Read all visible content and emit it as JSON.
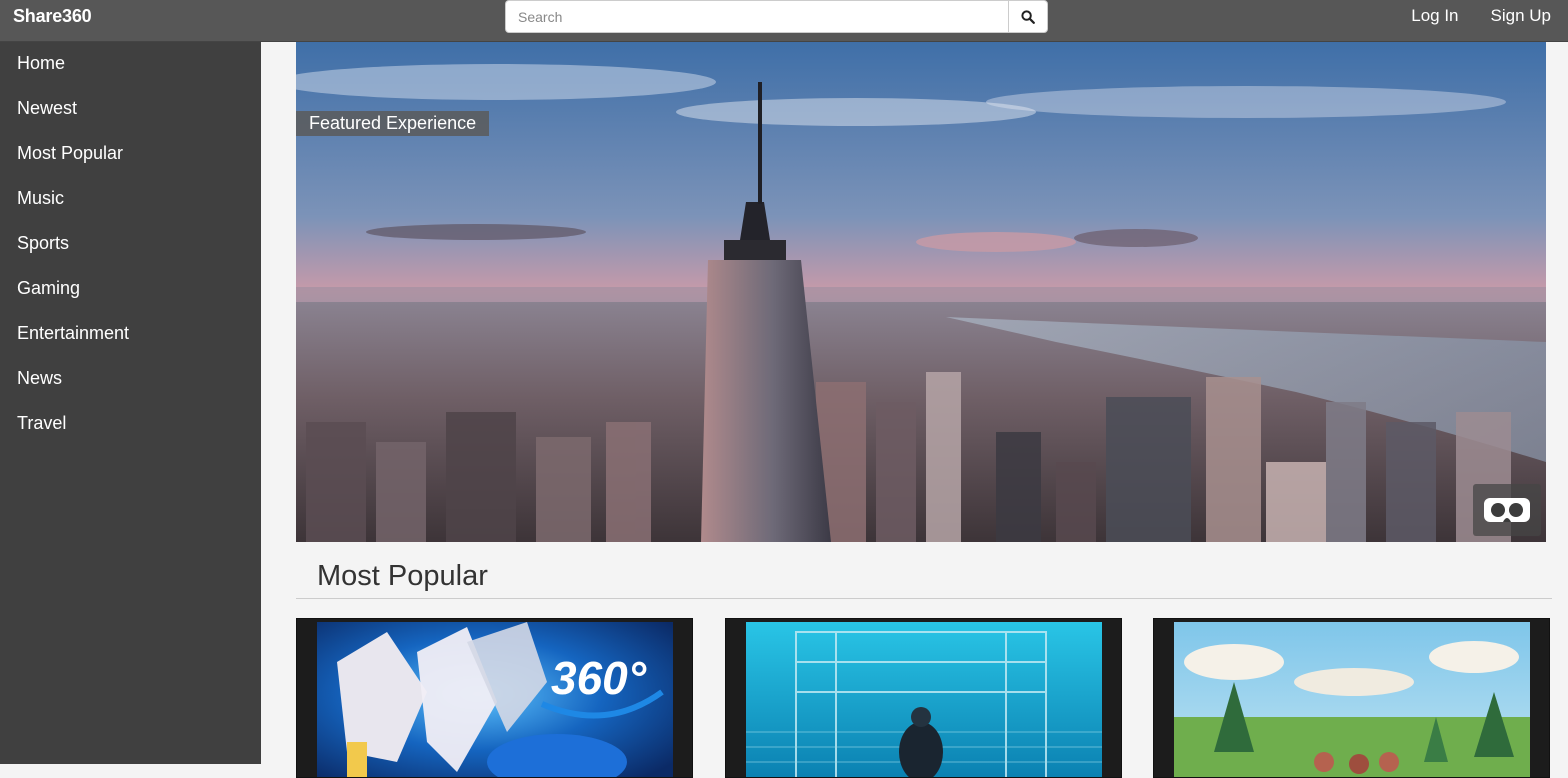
{
  "header": {
    "brand": "Share360",
    "search": {
      "placeholder": "Search",
      "value": ""
    },
    "login_label": "Log In",
    "signup_label": "Sign Up"
  },
  "sidebar": {
    "items": [
      {
        "label": "Home"
      },
      {
        "label": "Newest"
      },
      {
        "label": "Most Popular"
      },
      {
        "label": "Music"
      },
      {
        "label": "Sports"
      },
      {
        "label": "Gaming"
      },
      {
        "label": "Entertainment"
      },
      {
        "label": "News"
      },
      {
        "label": "Travel"
      }
    ]
  },
  "featured": {
    "badge": "Featured Experience"
  },
  "most_popular": {
    "title": "Most Popular",
    "cards": [
      {
        "thumb_text": "360°"
      },
      {
        "thumb_text": ""
      },
      {
        "thumb_text": ""
      }
    ]
  },
  "colors": {
    "topbar": "#575757",
    "sidebar": "#404040",
    "page_bg": "#f4f4f4",
    "accent_blue": "#1565c0"
  },
  "icons": {
    "search": "search-icon",
    "vr": "vr-headset-icon"
  }
}
